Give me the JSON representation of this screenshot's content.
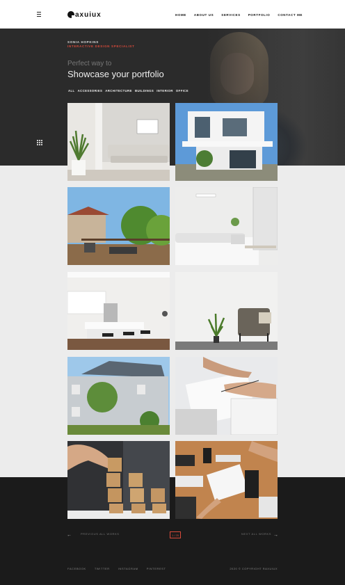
{
  "header": {
    "logo_text": "axuiux",
    "nav": [
      "HOME",
      "ABOUT US",
      "SERVICES",
      "PORTFOLIO",
      "CONTACT ME"
    ]
  },
  "hero": {
    "author": "SONIA HOPKINS",
    "role": "INTERACTIVE DESIGN SPECIALIST",
    "tagline": "Perfect way to",
    "headline": "Showcase your portfolio",
    "filters": [
      "ALL",
      "ACCESSORIES",
      "ARCHITECTURE",
      "BUILDINGS",
      "INTERIOR",
      "OFFICE"
    ]
  },
  "portfolio": {
    "items": [
      {
        "alt": "Living room with sofa"
      },
      {
        "alt": "Modern white house"
      },
      {
        "alt": "Wooden deck terrace"
      },
      {
        "alt": "White bedroom"
      },
      {
        "alt": "Modern kitchen"
      },
      {
        "alt": "Armchair by white wall"
      },
      {
        "alt": "Grey villa house"
      },
      {
        "alt": "Architect drawing plans"
      },
      {
        "alt": "Wooden blocks stacked"
      },
      {
        "alt": "Designers at desk"
      }
    ]
  },
  "pagination": {
    "prev_label": "PREVIOUS ALL WORKS",
    "next_label": "NEXT ALL WORKS",
    "page_indicator": "1 / 25"
  },
  "footer": {
    "social": [
      "FACEBOOK",
      "TWITTER",
      "INSTAGRAM",
      "PINTEREST"
    ],
    "copyright": "2020 © COPYRIGHT RAXUIUX"
  },
  "colors": {
    "accent": "#d84a3a",
    "dark": "#1b1b1b",
    "hero": "#2b2b2b",
    "page": "#ececec"
  }
}
